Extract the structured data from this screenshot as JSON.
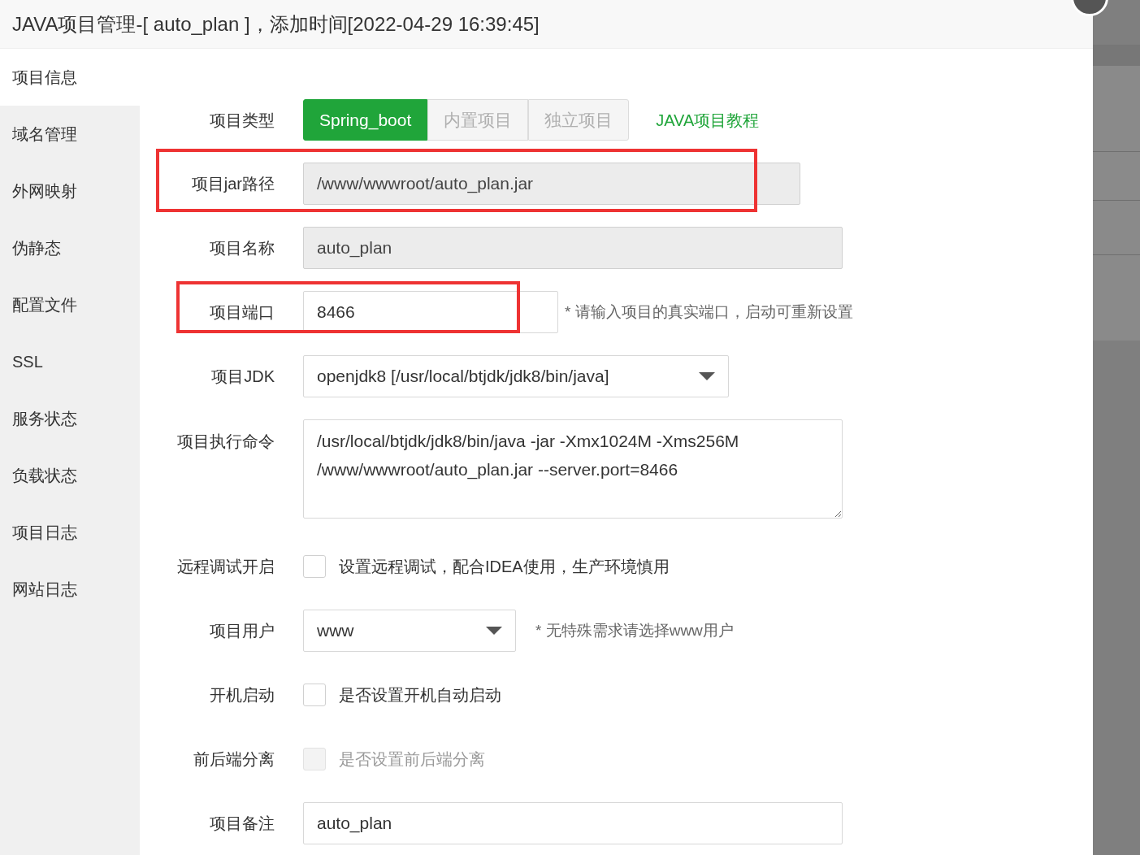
{
  "dialog": {
    "title": "JAVA项目管理-[ auto_plan ]，添加时间[2022-04-29 16:39:45]"
  },
  "sidebar": {
    "items": [
      {
        "label": "项目信息",
        "selected": true
      },
      {
        "label": "域名管理",
        "selected": false
      },
      {
        "label": "外网映射",
        "selected": false
      },
      {
        "label": "伪静态",
        "selected": false
      },
      {
        "label": "配置文件",
        "selected": false
      },
      {
        "label": "SSL",
        "selected": false
      },
      {
        "label": "服务状态",
        "selected": false
      },
      {
        "label": "负载状态",
        "selected": false
      },
      {
        "label": "项目日志",
        "selected": false
      },
      {
        "label": "网站日志",
        "selected": false
      }
    ]
  },
  "form": {
    "rows": [
      {
        "kind": "segmented",
        "label": "项目类型",
        "options": [
          {
            "label": "Spring_boot",
            "selected": true
          },
          {
            "label": "内置项目",
            "selected": false
          },
          {
            "label": "独立项目",
            "selected": false
          }
        ],
        "link": "JAVA项目教程"
      },
      {
        "kind": "input",
        "label": "项目jar路径",
        "value": "/www/wwwroot/auto_plan.jar",
        "disabled": true,
        "highlighted": true
      },
      {
        "kind": "input",
        "label": "项目名称",
        "value": "auto_plan",
        "disabled": true
      },
      {
        "kind": "input",
        "label": "项目端口",
        "value": "8466",
        "disabled": false,
        "highlighted": true,
        "hint": "* 请输入项目的真实端口，启动可重新设置"
      },
      {
        "kind": "select",
        "label": "项目JDK",
        "value": "openjdk8 [/usr/local/btjdk/jdk8/bin/java]"
      },
      {
        "kind": "textarea",
        "label": "项目执行命令",
        "lines": [
          "/usr/local/btjdk/jdk8/bin/java -jar -Xmx1024M -Xms256M",
          "/www/wwwroot/auto_plan.jar --server.port=8466"
        ]
      },
      {
        "kind": "checkbox",
        "label": "远程调试开启",
        "text": "设置远程调试，配合IDEA使用，生产环境慎用",
        "checked": false,
        "disabled": false
      },
      {
        "kind": "select",
        "label": "项目用户",
        "value": "www",
        "hint": "* 无特殊需求请选择www用户"
      },
      {
        "kind": "checkbox",
        "label": "开机启动",
        "text": "是否设置开机自动启动",
        "checked": false,
        "disabled": false
      },
      {
        "kind": "checkbox",
        "label": "前后端分离",
        "text": "是否设置前后端分离",
        "checked": false,
        "disabled": true
      },
      {
        "kind": "input",
        "label": "项目备注",
        "value": "auto_plan",
        "disabled": false
      }
    ]
  }
}
